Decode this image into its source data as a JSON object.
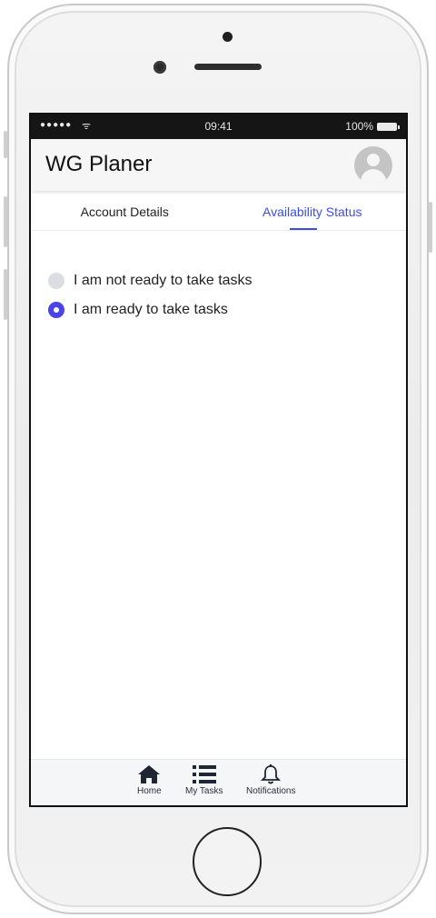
{
  "statusbar": {
    "signal": "●●●●●",
    "wifi": "ᯤ",
    "time": "09:41",
    "battery": "100%"
  },
  "appbar": {
    "title": "WG Planer"
  },
  "tabs": [
    {
      "label": "Account Details",
      "active": false
    },
    {
      "label": "Availability Status",
      "active": true
    }
  ],
  "availability": {
    "options": [
      {
        "label": "I am not ready to take tasks",
        "selected": false
      },
      {
        "label": "I am ready to take tasks",
        "selected": true
      }
    ]
  },
  "bottom_nav": [
    {
      "label": "Home",
      "icon": "home-icon"
    },
    {
      "label": "My Tasks",
      "icon": "list-icon"
    },
    {
      "label": "Notifications",
      "icon": "bell-icon"
    }
  ],
  "colors": {
    "accent": "#3c4fe0",
    "radio_selected": "#4b43ea",
    "radio_unselected": "#dcdce4"
  }
}
